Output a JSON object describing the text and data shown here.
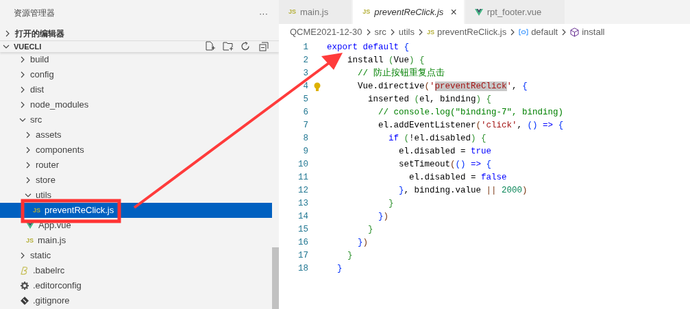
{
  "sidebar": {
    "title": "资源管理器",
    "more": "···",
    "sections": [
      {
        "label": "打开的编辑器",
        "expanded": false
      }
    ],
    "project": {
      "label": "VUECLI",
      "expanded": true
    },
    "tree": [
      {
        "label": "build",
        "kind": "folder",
        "expanded": false,
        "selected": false
      },
      {
        "label": "config",
        "kind": "folder",
        "expanded": false,
        "selected": false
      },
      {
        "label": "dist",
        "kind": "folder",
        "expanded": false,
        "selected": false
      },
      {
        "label": "node_modules",
        "kind": "folder",
        "expanded": false,
        "selected": false
      },
      {
        "label": "src",
        "kind": "folder",
        "expanded": true,
        "selected": false,
        "children": [
          {
            "label": "assets",
            "kind": "folder",
            "expanded": false,
            "selected": false
          },
          {
            "label": "components",
            "kind": "folder",
            "expanded": false,
            "selected": false
          },
          {
            "label": "router",
            "kind": "folder",
            "expanded": false,
            "selected": false
          },
          {
            "label": "store",
            "kind": "folder",
            "expanded": false,
            "selected": false
          },
          {
            "label": "utils",
            "kind": "folder",
            "expanded": true,
            "selected": false,
            "children": [
              {
                "label": "preventReClick.js",
                "kind": "js",
                "icon_text": "JS",
                "selected": true
              }
            ]
          },
          {
            "label": "App.vue",
            "kind": "vue",
            "selected": false
          },
          {
            "label": "main.js",
            "kind": "js",
            "icon_text": "JS",
            "selected": false
          }
        ]
      },
      {
        "label": "static",
        "kind": "folder",
        "expanded": false,
        "selected": false
      },
      {
        "label": ".babelrc",
        "kind": "babel",
        "selected": false
      },
      {
        "label": ".editorconfig",
        "kind": "config",
        "selected": false
      },
      {
        "label": ".gitignore",
        "kind": "git",
        "selected": false
      }
    ]
  },
  "tabs": [
    {
      "label": "main.js",
      "kind": "js",
      "icon_text": "JS",
      "selected": false
    },
    {
      "label": "preventReClick.js",
      "kind": "js",
      "icon_text": "JS",
      "selected": true,
      "close": "×"
    },
    {
      "label": "rpt_footer.vue",
      "kind": "vue",
      "selected": false
    }
  ],
  "breadcrumb": [
    {
      "label": "QCME2021-12-30",
      "kind": "text"
    },
    {
      "label": "src",
      "kind": "text"
    },
    {
      "label": "utils",
      "kind": "text"
    },
    {
      "label": "preventReClick.js",
      "kind": "js",
      "icon_text": "JS"
    },
    {
      "label": "default",
      "kind": "variable"
    },
    {
      "label": "install",
      "kind": "method"
    }
  ],
  "code": [
    {
      "number": "1",
      "tokens": [
        {
          "t": "export default ",
          "kind": "kw"
        },
        {
          "t": "{",
          "kind": "b1"
        }
      ]
    },
    {
      "number": "2",
      "tokens": [
        {
          "t": "    install ",
          "kind": "plain"
        },
        {
          "t": "(",
          "kind": "b2"
        },
        {
          "t": "Vue",
          "kind": "plain"
        },
        {
          "t": ") ",
          "kind": "b2"
        },
        {
          "t": "{",
          "kind": "b2"
        }
      ]
    },
    {
      "number": "3",
      "tokens": [
        {
          "t": "      // 防止按钮重复点击",
          "kind": "com"
        }
      ]
    },
    {
      "number": "4",
      "lightbulb": true,
      "tokens": [
        {
          "t": "      Vue.directive",
          "kind": "plain"
        },
        {
          "t": "(",
          "kind": "b3"
        },
        {
          "t": "'",
          "kind": "str"
        },
        {
          "t": "preventReClick",
          "kind": "strsel"
        },
        {
          "t": "'",
          "kind": "str"
        },
        {
          "t": ", ",
          "kind": "plain"
        },
        {
          "t": "{",
          "kind": "b1"
        }
      ]
    },
    {
      "number": "5",
      "tokens": [
        {
          "t": "        inserted ",
          "kind": "plain"
        },
        {
          "t": "(",
          "kind": "b2"
        },
        {
          "t": "el, binding",
          "kind": "plain"
        },
        {
          "t": ") ",
          "kind": "b2"
        },
        {
          "t": "{",
          "kind": "b2"
        }
      ]
    },
    {
      "number": "6",
      "tokens": [
        {
          "t": "          // console.log(\"binding-7\", binding)",
          "kind": "com"
        }
      ]
    },
    {
      "number": "7",
      "tokens": [
        {
          "t": "          el.addEventListener",
          "kind": "plain"
        },
        {
          "t": "(",
          "kind": "b3"
        },
        {
          "t": "'click'",
          "kind": "str"
        },
        {
          "t": ", ",
          "kind": "plain"
        },
        {
          "t": "()",
          "kind": "b1"
        },
        {
          "t": " => ",
          "kind": "kw"
        },
        {
          "t": "{",
          "kind": "b1"
        }
      ]
    },
    {
      "number": "8",
      "tokens": [
        {
          "t": "            if ",
          "kind": "kw"
        },
        {
          "t": "(",
          "kind": "b2"
        },
        {
          "t": "!el.disabled",
          "kind": "plain"
        },
        {
          "t": ") ",
          "kind": "b2"
        },
        {
          "t": "{",
          "kind": "b2"
        }
      ]
    },
    {
      "number": "9",
      "tokens": [
        {
          "t": "              el.disabled = ",
          "kind": "plain"
        },
        {
          "t": "true",
          "kind": "kw"
        }
      ]
    },
    {
      "number": "10",
      "tokens": [
        {
          "t": "              setTimeout",
          "kind": "plain"
        },
        {
          "t": "(",
          "kind": "b3"
        },
        {
          "t": "()",
          "kind": "b1"
        },
        {
          "t": " => ",
          "kind": "kw"
        },
        {
          "t": "{",
          "kind": "b1"
        }
      ]
    },
    {
      "number": "11",
      "tokens": [
        {
          "t": "                el.disabled = ",
          "kind": "plain"
        },
        {
          "t": "false",
          "kind": "kw"
        }
      ]
    },
    {
      "number": "12",
      "tokens": [
        {
          "t": "              }",
          "kind": "b1"
        },
        {
          "t": ", binding.value ",
          "kind": "plain"
        },
        {
          "t": "|| ",
          "kind": "b3"
        },
        {
          "t": "2000",
          "kind": "num"
        },
        {
          "t": ")",
          "kind": "b3"
        }
      ]
    },
    {
      "number": "13",
      "tokens": [
        {
          "t": "            }",
          "kind": "b2"
        }
      ]
    },
    {
      "number": "14",
      "tokens": [
        {
          "t": "          }",
          "kind": "b1"
        },
        {
          "t": ")",
          "kind": "b3"
        }
      ]
    },
    {
      "number": "15",
      "tokens": [
        {
          "t": "        }",
          "kind": "b2"
        }
      ]
    },
    {
      "number": "16",
      "tokens": [
        {
          "t": "      }",
          "kind": "b1"
        },
        {
          "t": ")",
          "kind": "b3"
        }
      ]
    },
    {
      "number": "17",
      "tokens": [
        {
          "t": "    }",
          "kind": "b2"
        }
      ]
    },
    {
      "number": "18",
      "tokens": [
        {
          "t": "  }",
          "kind": "b1"
        }
      ]
    }
  ]
}
